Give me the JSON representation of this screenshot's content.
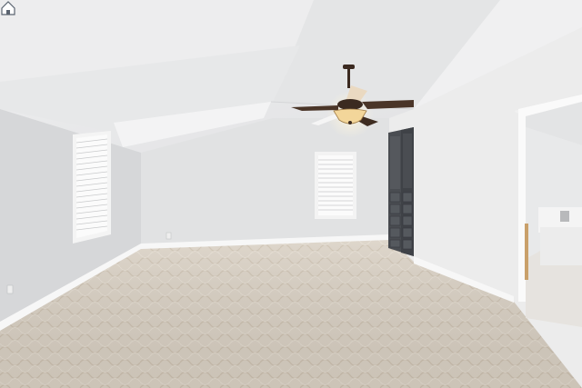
{
  "scene": {
    "subject": "empty-carpeted-bonus-room",
    "fan_light_on": true
  },
  "icons": {
    "watermark": "home-logo-icon"
  },
  "colors": {
    "ceiling": "#e9e9ea",
    "wall_left": "#d6d7d9",
    "wall_back": "#e1e2e3",
    "wall_right": "#ececec",
    "carpet": "#d9d0c3",
    "cabinet": "#4a4d52",
    "fan_blade": "#4a3528",
    "fan_light": "#f3d69a",
    "baseboard": "#f7f7f7"
  }
}
